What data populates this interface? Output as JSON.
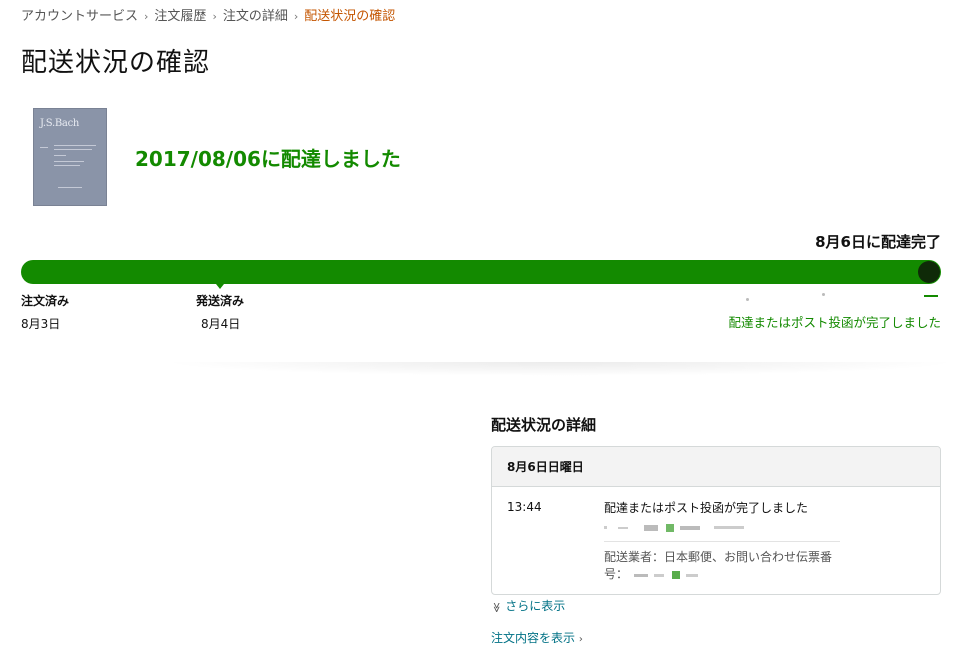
{
  "breadcrumb": {
    "items": [
      "アカウントサービス",
      "注文履歴",
      "注文の詳細"
    ],
    "current": "配送状況の確認",
    "separator": "›"
  },
  "page_title": "配送状況の確認",
  "product": {
    "cover_author": "J.S.Bach"
  },
  "delivery_headline": "2017/08/06に配達しました",
  "progress": {
    "status_label": "8月6日に配達完了",
    "fraction_complete": 1.0,
    "accent_color": "#138a00",
    "end_marker_color": "#0f2a08",
    "steps": [
      {
        "label": "注文済み",
        "date": "8月3日"
      },
      {
        "label": "発送済み",
        "date": "8月4日"
      }
    ],
    "final_step_text": "配達またはポスト投函が完了しました"
  },
  "details": {
    "heading": "配送状況の詳細",
    "day_label": "8月6日日曜日",
    "events": [
      {
        "time": "13:44",
        "text": "配達またはポスト投函が完了しました",
        "carrier_text": "配送業者：日本郵便、お問い合わせ伝票番号："
      }
    ],
    "show_more": "さらに表示",
    "show_more_icon": "double-chevron-down-icon"
  },
  "order_link": "注文内容を表示",
  "order_link_icon": "chevron-right-icon",
  "colors": {
    "link": "#007185",
    "breadcrumb_current": "#c45500",
    "success": "#138a00"
  }
}
